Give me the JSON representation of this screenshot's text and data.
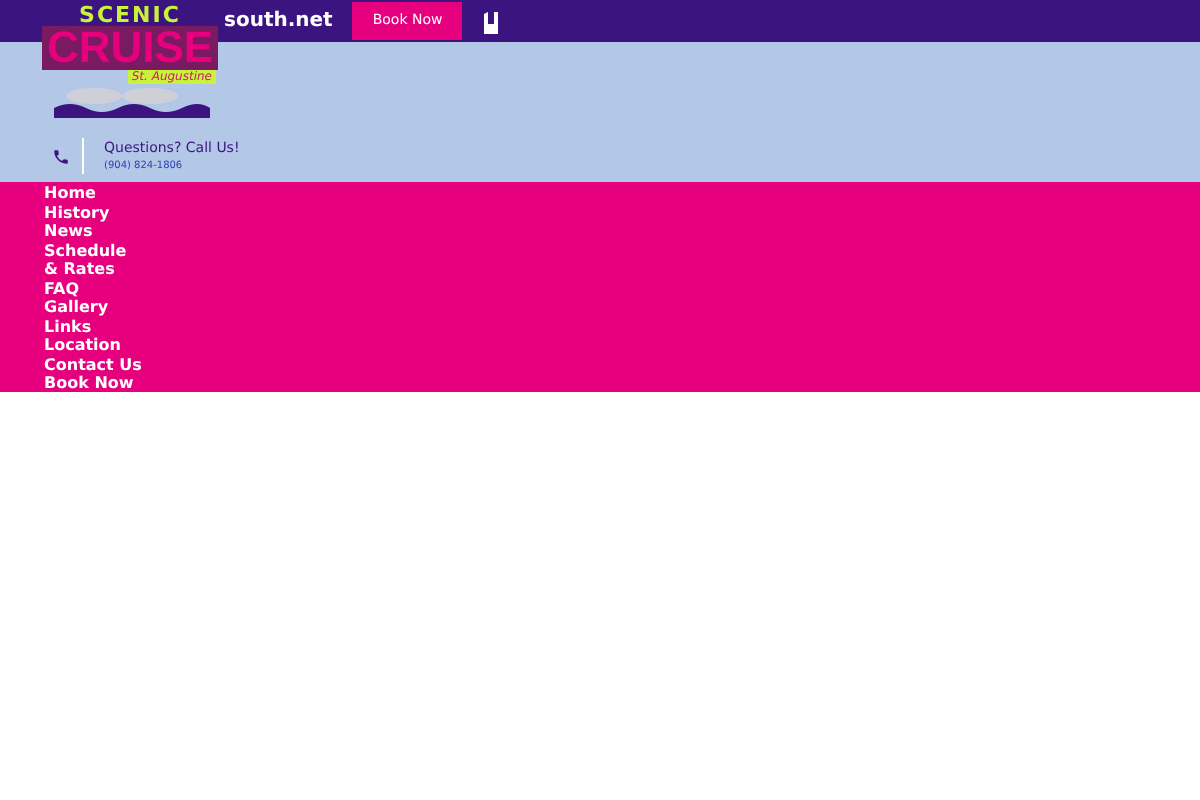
{
  "top_bar": {
    "email": "south.net",
    "book_button": "Book Now"
  },
  "logo": {
    "line_1": "SCENIC",
    "line_2": "CRUISE",
    "line_3": "St. Augustine"
  },
  "contact": {
    "heading": "Questions? Call Us!",
    "phone": "(904) 824-1806"
  },
  "nav": [
    {
      "label": "Home"
    },
    {
      "label": "History"
    },
    {
      "label": "News"
    },
    {
      "label": "Schedule & Rates"
    },
    {
      "label": "FAQ"
    },
    {
      "label": "Gallery"
    },
    {
      "label": "Links"
    },
    {
      "label": "Location"
    },
    {
      "label": "Contact Us"
    },
    {
      "label": "Book Now"
    }
  ]
}
